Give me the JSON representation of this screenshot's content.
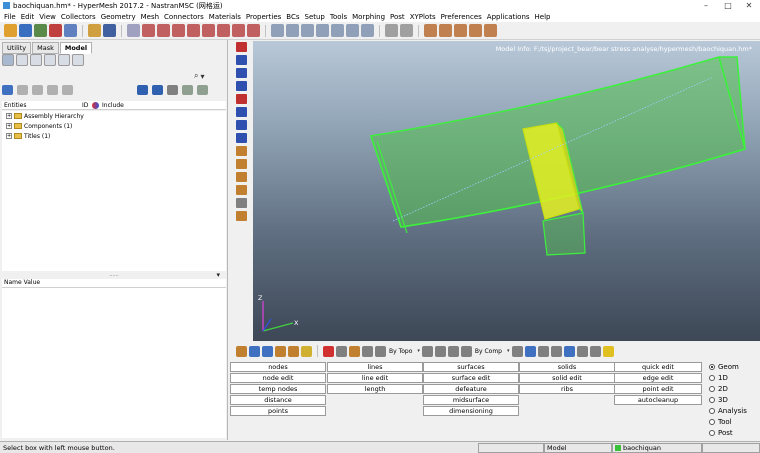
{
  "window": {
    "title": "baochiquan.hm* - HyperMesh 2017.2 - NastranMSC (网格运)",
    "minimize_glyph": "–",
    "maximize_glyph": "□",
    "close_glyph": "✕"
  },
  "menu": [
    "File",
    "Edit",
    "View",
    "Collectors",
    "Geometry",
    "Mesh",
    "Connectors",
    "Materials",
    "Properties",
    "BCs",
    "Setup",
    "Tools",
    "Morphing",
    "Post",
    "XYPlots",
    "Preferences",
    "Applications",
    "Help"
  ],
  "left_panel": {
    "tabs": [
      "Utility",
      "Mask",
      "Model"
    ],
    "active_tab": "Model",
    "search_glyph": "⌕",
    "dropdown_glyph": "▾",
    "entities_header": {
      "col1": "Entities",
      "col2": "ID",
      "col3": "Include"
    },
    "tree": [
      {
        "label": "Assembly Hierarchy"
      },
      {
        "label": "Components (1)"
      },
      {
        "label": "Titles (1)"
      }
    ],
    "divider_glyph": "......",
    "name_value_header": "Name Value"
  },
  "viewport": {
    "model_info": "Model Info: F:/tsj/project_bear/bear stress analyse/hypermesh/baochiquan.hm*",
    "axis_z": "Z",
    "axis_x": "X"
  },
  "bottom_toolbar": {
    "by_topo": "By Topo",
    "by_comp": "By Comp",
    "dd": "▾"
  },
  "menu_grid": {
    "col1": [
      "nodes",
      "node edit",
      "temp nodes",
      "distance",
      "points"
    ],
    "col2": [
      "lines",
      "line edit",
      "length"
    ],
    "col3": [
      "surfaces",
      "surface edit",
      "defeature",
      "midsurface",
      "dimensioning"
    ],
    "col4": [
      "solids",
      "solid edit",
      "ribs"
    ],
    "col5": [
      "quick edit",
      "edge edit",
      "point edit",
      "autocleanup"
    ]
  },
  "radios": [
    {
      "label": "Geom",
      "checked": true
    },
    {
      "label": "1D",
      "checked": false
    },
    {
      "label": "2D",
      "checked": false
    },
    {
      "label": "3D",
      "checked": false
    },
    {
      "label": "Analysis",
      "checked": false
    },
    {
      "label": "Tool",
      "checked": false
    },
    {
      "label": "Post",
      "checked": false
    }
  ],
  "status": {
    "message": "Select box with left mouse button.",
    "model": "Model",
    "component": "baochiquan"
  },
  "colors": {
    "green_surface": "#54c04e",
    "yellow_surface": "#e4f020",
    "edge_green": "#3cf03c"
  }
}
